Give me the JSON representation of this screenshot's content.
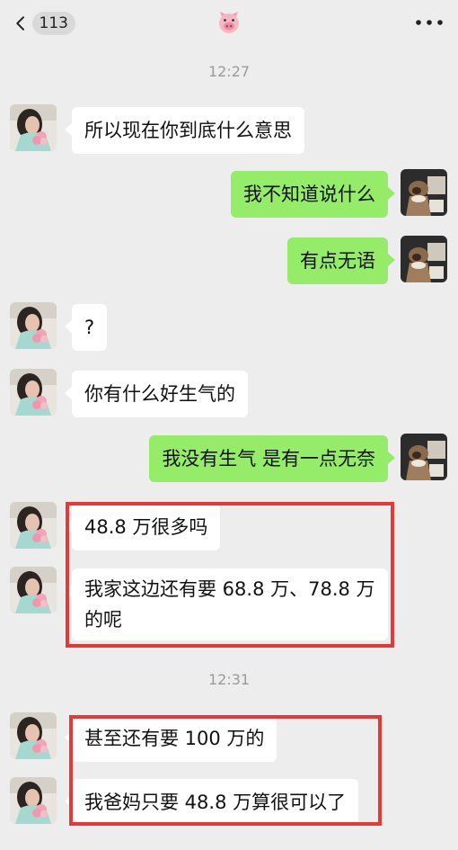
{
  "header": {
    "unread_count": "113",
    "contact_icon": "pig-face-icon",
    "menu_icon": "more-dots-icon"
  },
  "timestamps": [
    "12:27",
    "12:31"
  ],
  "messages": [
    {
      "side": "left",
      "text": "所以现在你到底什么意思"
    },
    {
      "side": "right",
      "text": "我不知道说什么"
    },
    {
      "side": "right",
      "text": "有点无语"
    },
    {
      "side": "left",
      "text": "?"
    },
    {
      "side": "left",
      "text": "你有什么好生气的"
    },
    {
      "side": "right",
      "text": "我没有生气  是有一点无奈"
    },
    {
      "side": "left",
      "text": "48.8 万很多吗"
    },
    {
      "side": "left",
      "line1": "我家这边还有要 68.8 万、78.8 万",
      "line2": "的呢"
    },
    {
      "side": "left",
      "text": "甚至还有要 100 万的"
    },
    {
      "side": "left",
      "text": "我爸妈只要 48.8 万算很可以了"
    }
  ],
  "colors": {
    "background": "#ededed",
    "bubble_mine": "#95ec69",
    "bubble_theirs": "#ffffff",
    "highlight_box": "#e53935"
  }
}
